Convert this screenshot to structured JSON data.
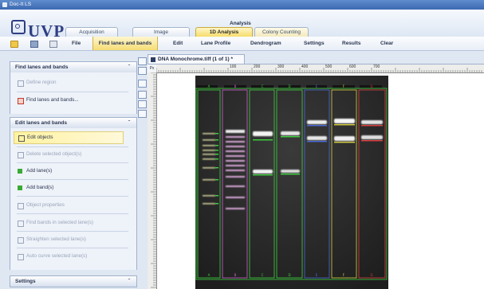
{
  "window": {
    "title": "Doc-It LS"
  },
  "brand": {
    "logo_text": "UVP"
  },
  "header": {
    "group_label": "Analysis"
  },
  "mode_tabs": [
    {
      "label": "Acquisition"
    },
    {
      "label": "Image"
    },
    {
      "label": "1D Analysis"
    },
    {
      "label": "Colony Counting"
    }
  ],
  "toolbar": {
    "items": [
      {
        "label": "File"
      },
      {
        "label": "Find lanes and bands"
      },
      {
        "label": "Edit"
      },
      {
        "label": "Lane Profile"
      },
      {
        "label": "Dendrogram"
      },
      {
        "label": "Settings"
      },
      {
        "label": "Results"
      },
      {
        "label": "Clear"
      }
    ]
  },
  "panels": {
    "find": {
      "title": "Find lanes and bands",
      "chevron": "ˆ",
      "items": [
        {
          "label": "Define region"
        },
        {
          "label": "Find lanes and bands..."
        }
      ]
    },
    "edit": {
      "title": "Edit lanes and bands",
      "chevron": "ˆ",
      "items": [
        {
          "label": "Edit objects"
        },
        {
          "label": "Delete selected object(s)"
        },
        {
          "label": "Add lane(s)"
        },
        {
          "label": "Add band(s)"
        },
        {
          "label": "Object properties"
        },
        {
          "label": "Find bands in selected lane(s)"
        },
        {
          "label": "Straighten selected lane(s)"
        },
        {
          "label": "Auto curve selected lane(s)"
        }
      ]
    },
    "settings": {
      "title": "Settings",
      "chevron": "ˇ"
    }
  },
  "document": {
    "tab_title": "DNA Monochrome.tiff (1 of 1) *",
    "ruler_unit": "Px",
    "ruler_ticks": [
      "100",
      "200",
      "300",
      "400",
      "500",
      "600",
      "700"
    ]
  },
  "gel": {
    "lane_labels_top": [
      "A",
      "B",
      "C",
      "D",
      "E",
      "F",
      "G"
    ],
    "lane_labels_bottom": [
      "A",
      "B",
      "C",
      "D",
      "E",
      "F",
      "G"
    ]
  },
  "colors": {
    "accent_yellow": "#f6dc6a",
    "lane_green": "#3fd43f",
    "lane_magenta": "#d060d0",
    "lane_blue": "#4a6ad8",
    "lane_red": "#e04040",
    "lane_yellow": "#d8d040"
  }
}
